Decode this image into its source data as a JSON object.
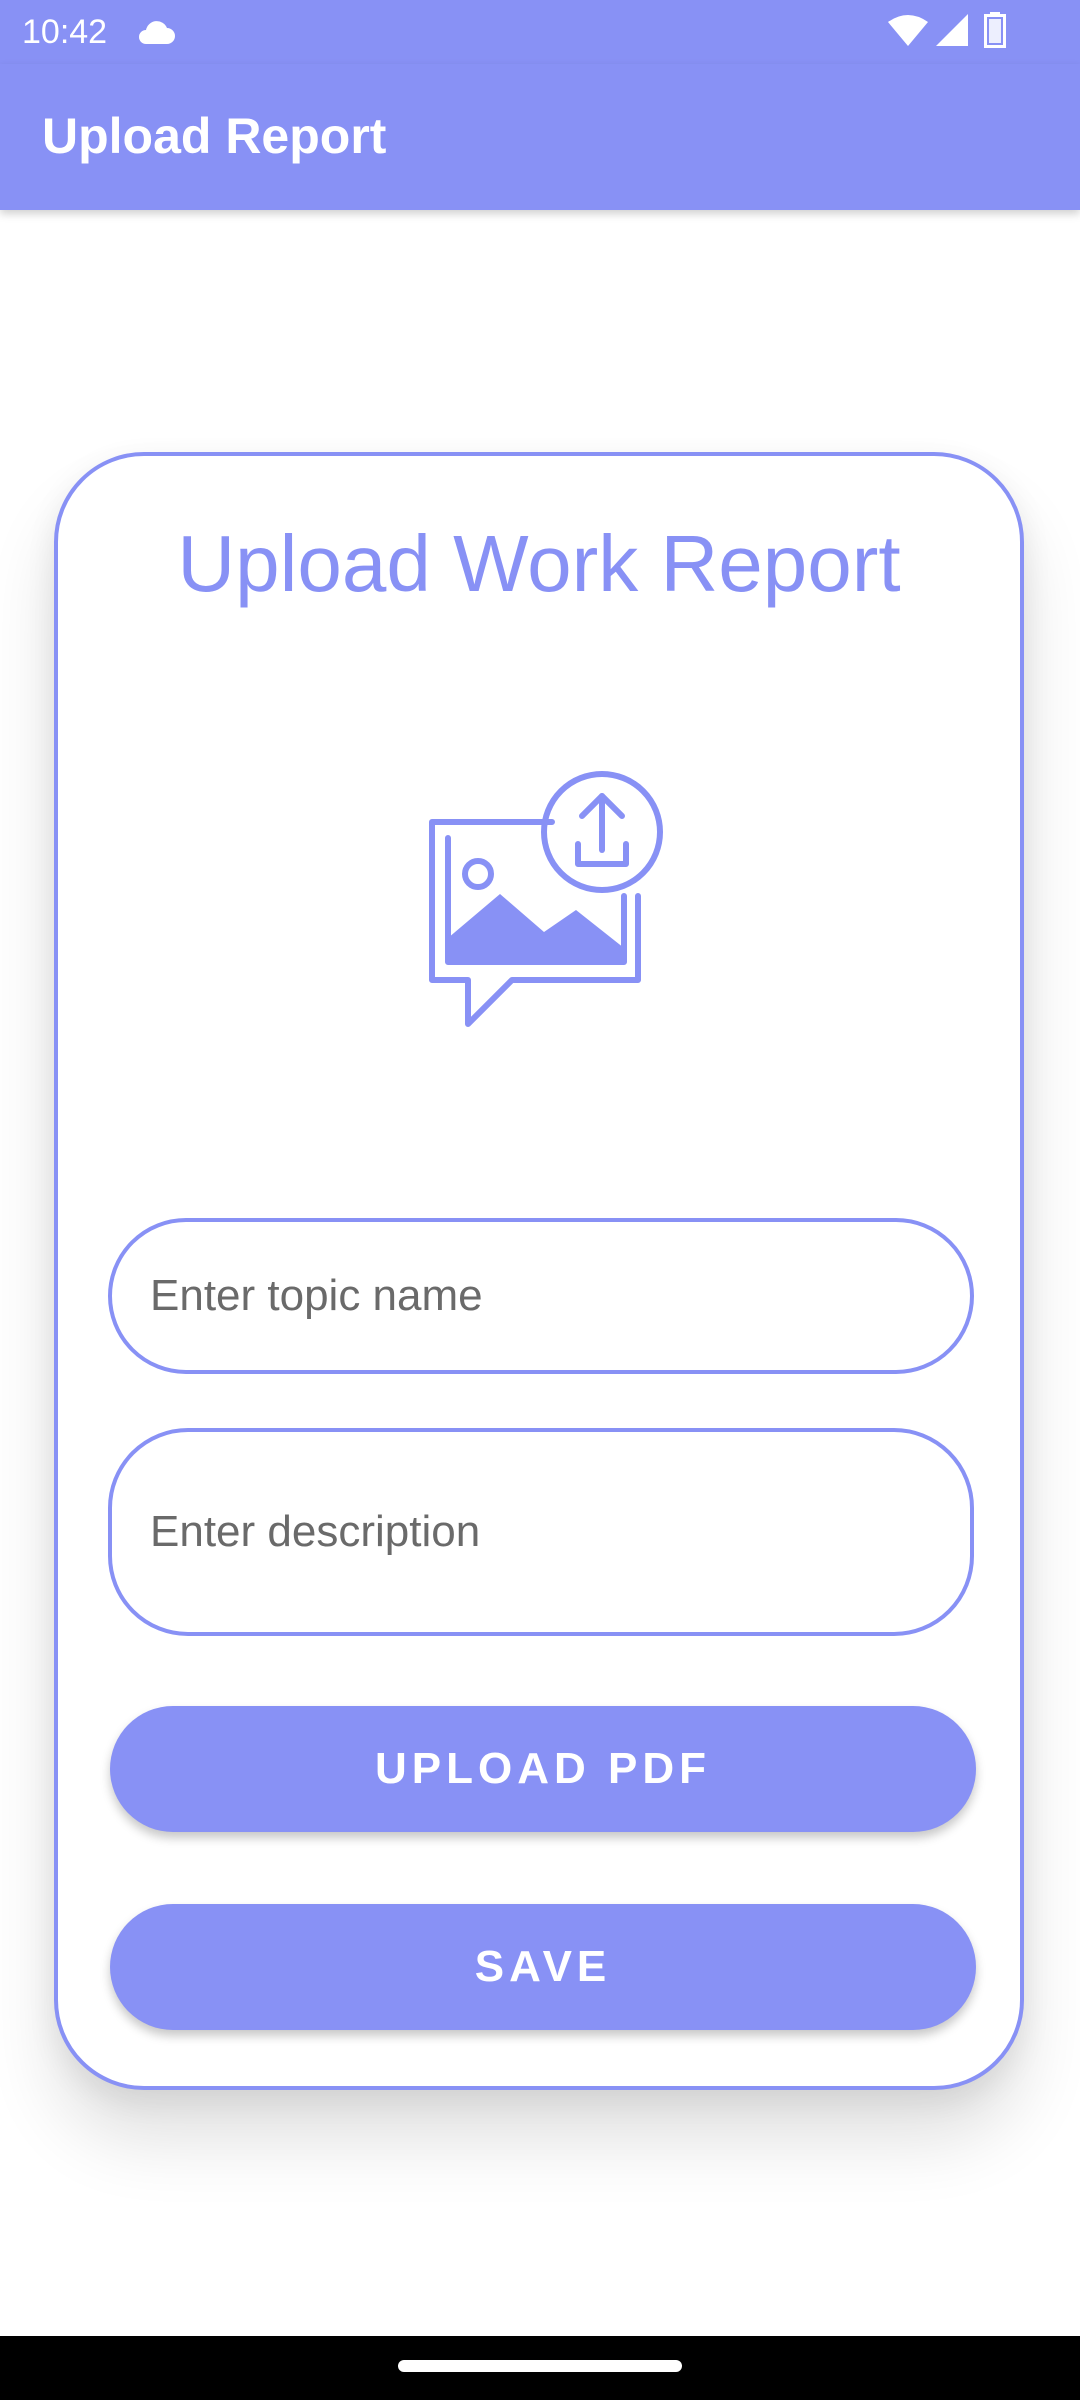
{
  "status_bar": {
    "time": "10:42",
    "icons": [
      "cloud-icon",
      "wifi-icon",
      "cell-signal-icon",
      "battery-icon"
    ]
  },
  "app_bar": {
    "title": "Upload Report"
  },
  "card": {
    "title": "Upload Work Report",
    "illustration_icon": "image-upload-icon",
    "topic_field": {
      "placeholder": "Enter topic name",
      "value": ""
    },
    "description_field": {
      "placeholder": "Enter description",
      "value": ""
    },
    "upload_button_label": "UPLOAD PDF",
    "save_button_label": "SAVE"
  },
  "colors": {
    "accent": "#8891f5",
    "background": "#ffffff",
    "placeholder_text": "#6a6a6a",
    "nav_bar": "#000000"
  }
}
